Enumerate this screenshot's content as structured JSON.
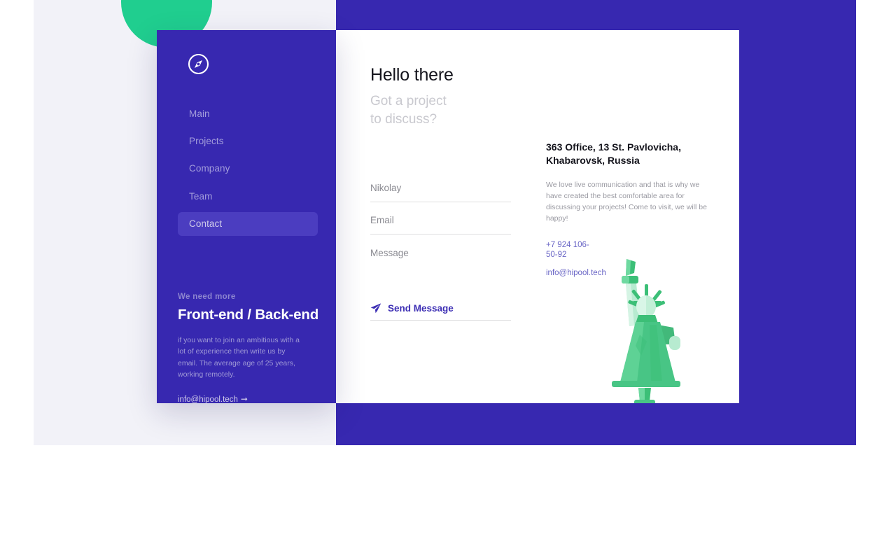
{
  "theme": {
    "purple": "#3728b0",
    "purple_active": "#4b3dc0",
    "green": "#20ce8f",
    "page_bg": "#f2f2f8",
    "card_bg": "#ffffff",
    "link_purple": "#6a66c6",
    "accent_text": "#3d2fb4"
  },
  "sidebar": {
    "logo_icon": "compass-icon",
    "nav": [
      {
        "label": "Main",
        "active": false
      },
      {
        "label": "Projects",
        "active": false
      },
      {
        "label": "Company",
        "active": false
      },
      {
        "label": "Team",
        "active": false
      },
      {
        "label": "Contact",
        "active": true
      }
    ],
    "recruit": {
      "kicker": "We need more",
      "title": "Front-end / Back-end",
      "text": "if you want to join an ambitious with a lot of experience then write us by email. The average age of 25 years, working remotely.",
      "link": "info@hipool.tech",
      "link_arrow": "➞"
    }
  },
  "main": {
    "heading": "Hello there",
    "subtitle_line1": "Got a project",
    "subtitle_line2": "to discuss?",
    "form": {
      "name_placeholder": "Nikolay",
      "name_value": "",
      "email_placeholder": "Email",
      "email_value": "",
      "message_placeholder": "Message",
      "message_value": "",
      "submit_label": "Send Message",
      "submit_icon": "paper-plane-icon"
    }
  },
  "info": {
    "address": "363 Office, 13 St. Pavlovicha, Khabarovsk, Russia",
    "description": "We love live communication and that is why we have created the best comfortable area for discussing your projects! Come to visit, we will be happy!",
    "phone": "+7 924 106-50-92",
    "email": "info@hipool.tech",
    "illustration": "statue-of-liberty-illustration"
  }
}
